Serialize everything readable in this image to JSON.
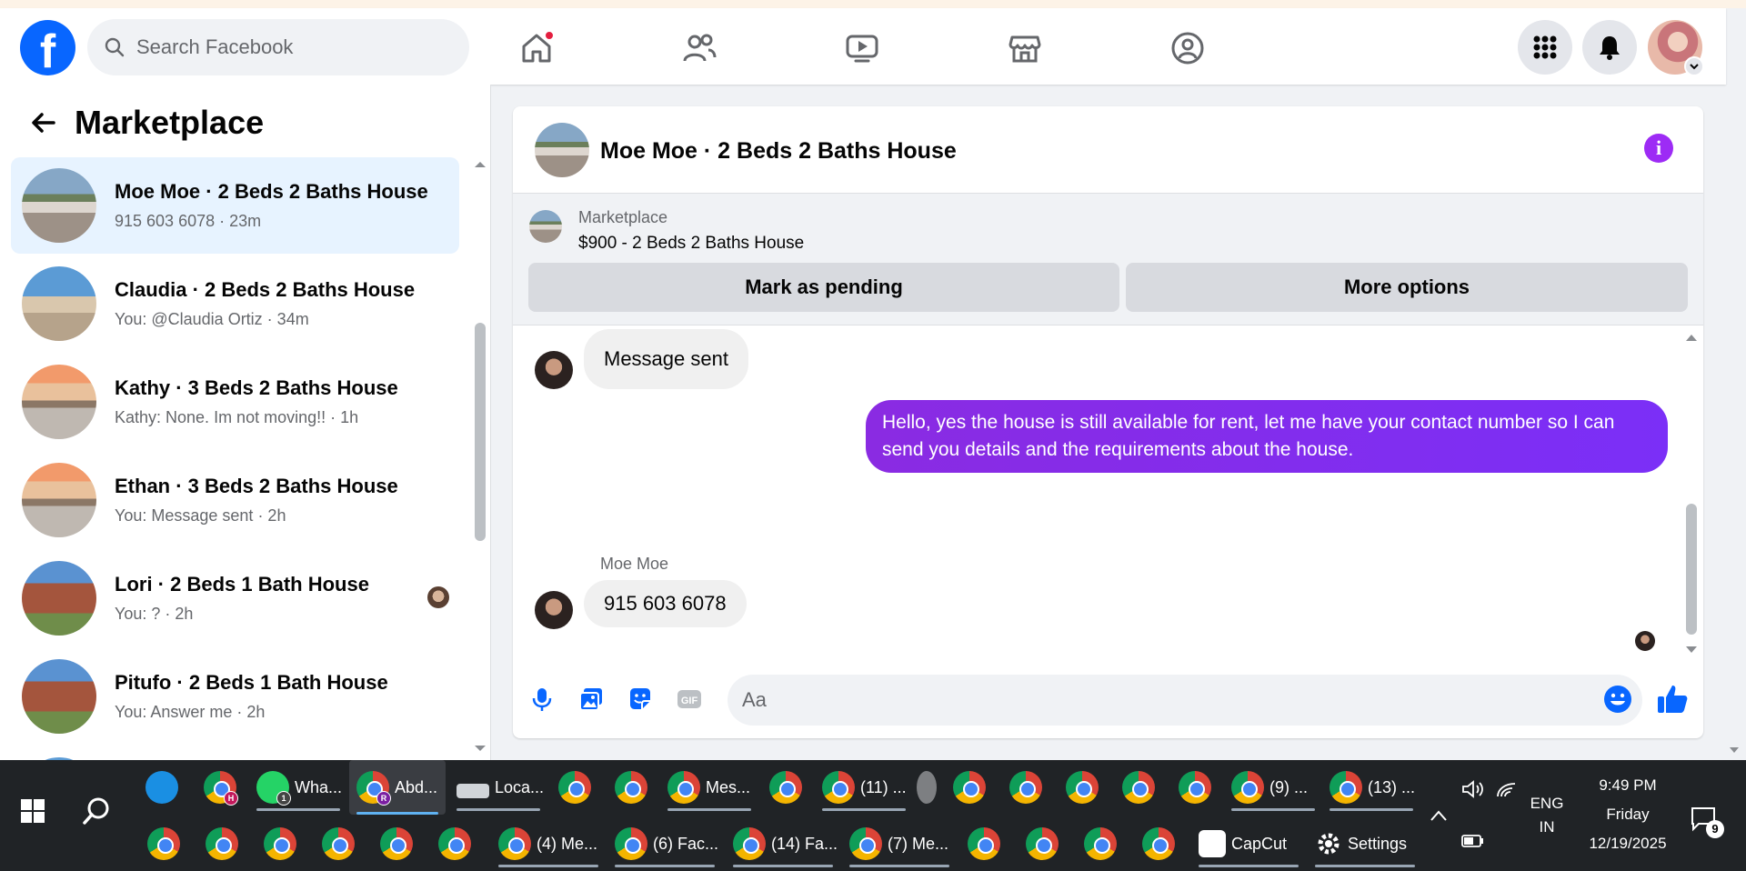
{
  "nav": {
    "search_placeholder": "Search Facebook",
    "logo_letter": "f"
  },
  "sidebar": {
    "title": "Marketplace",
    "conversations": [
      {
        "title": "Moe Moe · 2 Beds 2 Baths House",
        "sub": "915 603 6078 · 23m",
        "active": true
      },
      {
        "title": "Claudia · 2 Beds 2 Baths House",
        "sub": "You: @Claudia Ortiz · 34m"
      },
      {
        "title": "Kathy · 3 Beds 2 Baths House",
        "sub": "Kathy: None. Im not moving!! · 1h"
      },
      {
        "title": "Ethan · 3 Beds 2 Baths House",
        "sub": "You: Message sent · 2h"
      },
      {
        "title": "Lori · 2 Beds 1 Bath House",
        "sub": "You: ? · 2h"
      },
      {
        "title": "Pitufo · 2 Beds 1 Bath House",
        "sub": "You: Answer me · 2h"
      }
    ]
  },
  "chat": {
    "title": "Moe Moe · 2 Beds 2 Baths House",
    "listing_label": "Marketplace",
    "listing_title": "$900 - 2 Beds 2 Baths House",
    "mark_pending_label": "Mark as pending",
    "more_options_label": "More options",
    "messages": [
      {
        "dir": "in",
        "text": "Message sent"
      },
      {
        "dir": "out",
        "text": "Hello, yes the house is still available for rent, let me have your contact number so I can send you details and the requirements about the house."
      },
      {
        "dir": "in",
        "sender": "Moe Moe",
        "text": "915 603 6078"
      }
    ],
    "composer_placeholder": "Aa"
  },
  "taskbar": {
    "row1": [
      {
        "label": "Wha...",
        "badge": "1"
      },
      {
        "label": "Abd...",
        "badge": "R"
      },
      {
        "label": "Loca..."
      },
      {
        "label": "Mes..."
      },
      {
        "label": "(11) ..."
      },
      {
        "label": "(9) ..."
      },
      {
        "label": "(13) ..."
      }
    ],
    "row2": [
      {
        "label": "(4) Me..."
      },
      {
        "label": "(6) Fac..."
      },
      {
        "label": "(14) Fa..."
      },
      {
        "label": "(7) Me..."
      },
      {
        "label": "CapCut"
      },
      {
        "label": "Settings"
      }
    ],
    "lang_line1": "ENG",
    "lang_line2": "IN",
    "time": "9:49 PM",
    "day": "Friday",
    "date": "12/19/2025",
    "notif_count": "9"
  },
  "colors": {
    "brand": "#0866ff",
    "bubble_out": "#8a2be2",
    "active_item": "#e7f3ff",
    "info": "#9d2bf5"
  }
}
